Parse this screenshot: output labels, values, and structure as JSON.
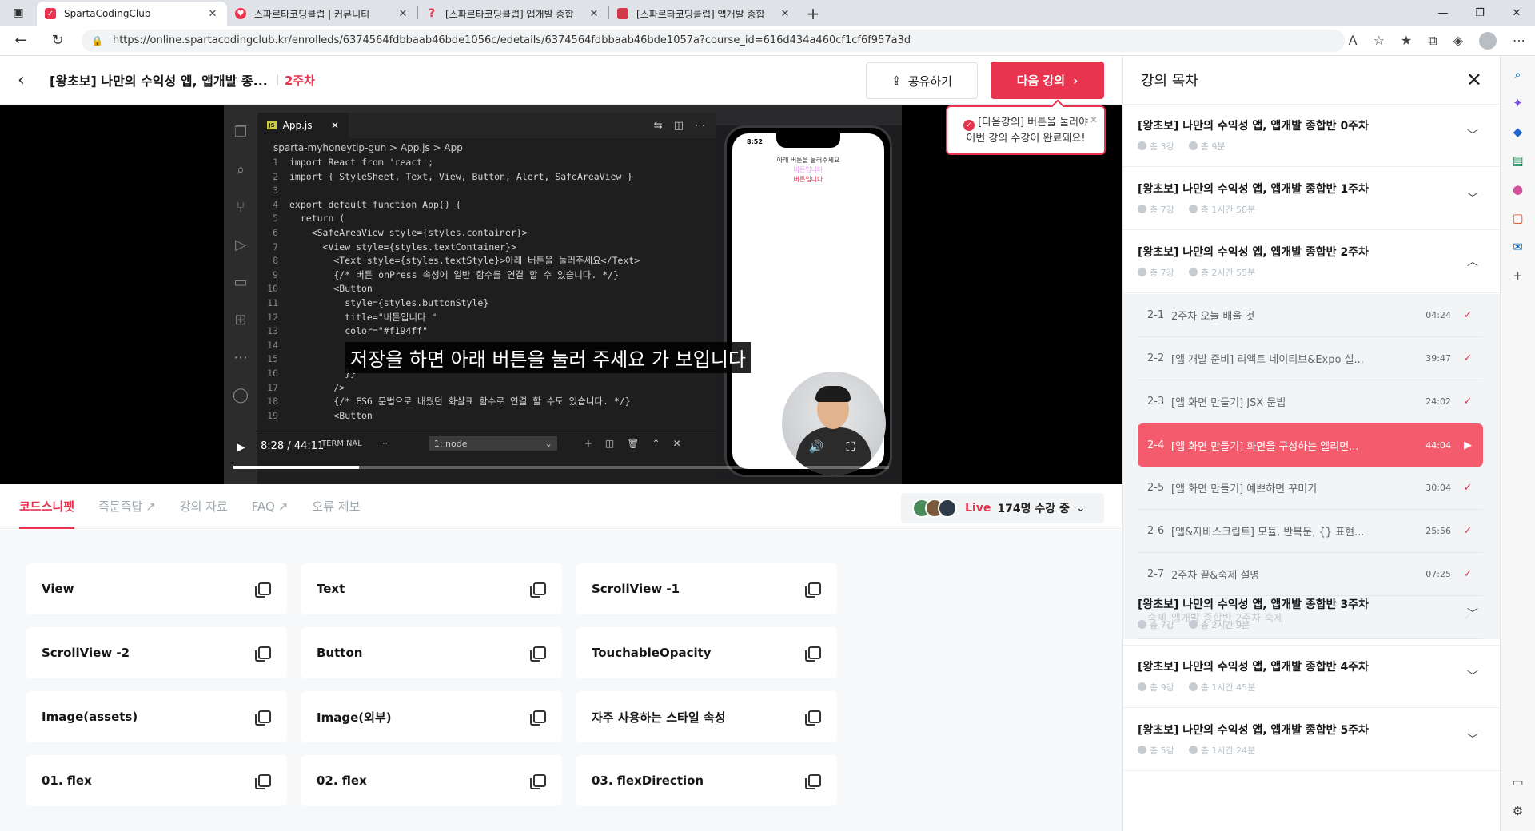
{
  "browser": {
    "tabs": [
      {
        "title": "SpartaCodingClub",
        "active": true,
        "favicon_color": "#e8344e"
      },
      {
        "title": "스파르타코딩클럽 | 커뮤니티",
        "active": false,
        "favicon_color": "#e8344e"
      },
      {
        "title": "[스파르타코딩클럽] 앱개발 종합",
        "active": false,
        "favicon_color": "#e8344e"
      },
      {
        "title": "[스파르타코딩클럽] 앱개발 종합",
        "active": false,
        "favicon_color": "#d23a4a"
      }
    ],
    "url": "https://online.spartacodingclub.kr/enrolleds/6374564fdbbaab46bde1056c/edetails/6374564fdbbaab46bde1057a?course_id=616d434a460cf1cf6f957a3d"
  },
  "header": {
    "course_title": "[왕초보] 나만의 수익성 앱, 앱개발 종...",
    "week_label": "2주차",
    "share_label": "공유하기",
    "next_label": "다음 강의"
  },
  "toast": {
    "tag": "[다음강의]",
    "line1": " 버튼을 눌러야",
    "line2": "이번 강의 수강이 완료돼요!"
  },
  "video": {
    "subtitle": "저장을 하면 아래 버튼을 눌러 주세요 가 보입니다",
    "time": "8:28 / 44:11",
    "progress": 0.192,
    "vscode": {
      "tab": "App.js",
      "breadcrumb": "sparta-myhoneytip-gun > App.js > App",
      "terminal_tab": "TERMINAL",
      "terminal_select": "1: node",
      "code_lines": [
        {
          "n": "1",
          "t": "import React from 'react';"
        },
        {
          "n": "2",
          "t": "import { StyleSheet, Text, View, Button, Alert, SafeAreaView }"
        },
        {
          "n": "3",
          "t": ""
        },
        {
          "n": "4",
          "t": "export default function App() {"
        },
        {
          "n": "5",
          "t": "  return ("
        },
        {
          "n": "6",
          "t": "    <SafeAreaView style={styles.container}>"
        },
        {
          "n": "7",
          "t": "      <View style={styles.textContainer}>"
        },
        {
          "n": "8",
          "t": "        <Text style={styles.textStyle}>아래 버튼을 눌러주세요</Text>"
        },
        {
          "n": "9",
          "t": "        {/* 버튼 onPress 속성에 일반 함수를 연결 할 수 있습니다. */}"
        },
        {
          "n": "10",
          "t": "        <Button"
        },
        {
          "n": "11",
          "t": "          style={styles.buttonStyle}"
        },
        {
          "n": "12",
          "t": "          title=\"버튼입니다 \""
        },
        {
          "n": "13",
          "t": "          color=\"#f194ff\""
        },
        {
          "n": "14",
          "t": ""
        },
        {
          "n": "15",
          "t": ""
        },
        {
          "n": "16",
          "t": "          }}"
        },
        {
          "n": "17",
          "t": "        />"
        },
        {
          "n": "18",
          "t": "        {/* ES6 문법으로 배웠던 화살표 함수로 연결 할 수도 있습니다. */}"
        },
        {
          "n": "19",
          "t": "        <Button"
        }
      ]
    },
    "phone": {
      "time": "8:52",
      "text1": "아래 버튼을 눌러주세요",
      "text2": "버튼입니다",
      "text3": "버튼입니다"
    }
  },
  "lower_tabs": [
    {
      "label": "코드스니펫",
      "active": true,
      "external": false
    },
    {
      "label": "즉문즉답",
      "active": false,
      "external": true
    },
    {
      "label": "강의 자료",
      "active": false,
      "external": false
    },
    {
      "label": "FAQ",
      "active": false,
      "external": true
    },
    {
      "label": "오류 제보",
      "active": false,
      "external": false
    }
  ],
  "live": {
    "label": "Live",
    "count": "174명 수강 중"
  },
  "snippets": [
    "View",
    "Text",
    "ScrollView -1",
    "ScrollView -2",
    "Button",
    "TouchableOpacity",
    "Image(assets)",
    "Image(외부)",
    "자주 사용하는 스타일 속성",
    "01. flex",
    "02. flex",
    "03. flexDirection"
  ],
  "toc": {
    "title": "강의 목차",
    "weeks": [
      {
        "name": "[왕초보] 나만의 수익성 앱, 앱개발 종합반 0주차",
        "count": "총 3강",
        "duration": "총 9분",
        "expanded": false
      },
      {
        "name": "[왕초보] 나만의 수익성 앱, 앱개발 종합반 1주차",
        "count": "총 7강",
        "duration": "총 1시간 58분",
        "expanded": false
      },
      {
        "name": "[왕초보] 나만의 수익성 앱, 앱개발 종합반 2주차",
        "count": "총 7강",
        "duration": "총 2시간 55분",
        "expanded": true
      },
      {
        "name": "[왕초보] 나만의 수익성 앱, 앱개발 종합반 3주차",
        "count": "총 7강",
        "duration": "총 2시간 9분",
        "expanded": false
      },
      {
        "name": "[왕초보] 나만의 수익성 앱, 앱개발 종합반 4주차",
        "count": "총 9강",
        "duration": "총 1시간 45분",
        "expanded": false
      },
      {
        "name": "[왕초보] 나만의 수익성 앱, 앱개발 종합반 5주차",
        "count": "총 5강",
        "duration": "총 1시간 24분",
        "expanded": false
      }
    ],
    "lessons": [
      {
        "num": "2-1",
        "title": "2주차 오늘 배울 것",
        "duration": "04:24",
        "state": "done"
      },
      {
        "num": "2-2",
        "title": "[앱 개발 준비] 리액트 네이티브&Expo 설...",
        "duration": "39:47",
        "state": "done"
      },
      {
        "num": "2-3",
        "title": "[앱 화면 만들기] JSX 문법",
        "duration": "24:02",
        "state": "done"
      },
      {
        "num": "2-4",
        "title": "[앱 화면 만들기] 화면을 구성하는 엘리먼...",
        "duration": "44:04",
        "state": "current"
      },
      {
        "num": "2-5",
        "title": "[앱 화면 만들기] 예쁘하면 꾸미기",
        "duration": "30:04",
        "state": "done"
      },
      {
        "num": "2-6",
        "title": "[앱&자바스크립트] 모듈, 반복문, {} 표현...",
        "duration": "25:56",
        "state": "done"
      },
      {
        "num": "2-7",
        "title": "2주차 끝&숙제 설명",
        "duration": "07:25",
        "state": "done"
      },
      {
        "num": "숙제",
        "title": "앱개발 종합반 2주차 숙제",
        "duration": "",
        "state": "dim"
      }
    ]
  },
  "colors": {
    "brand": "#e8344e",
    "current_lesson": "#f45c6e"
  }
}
